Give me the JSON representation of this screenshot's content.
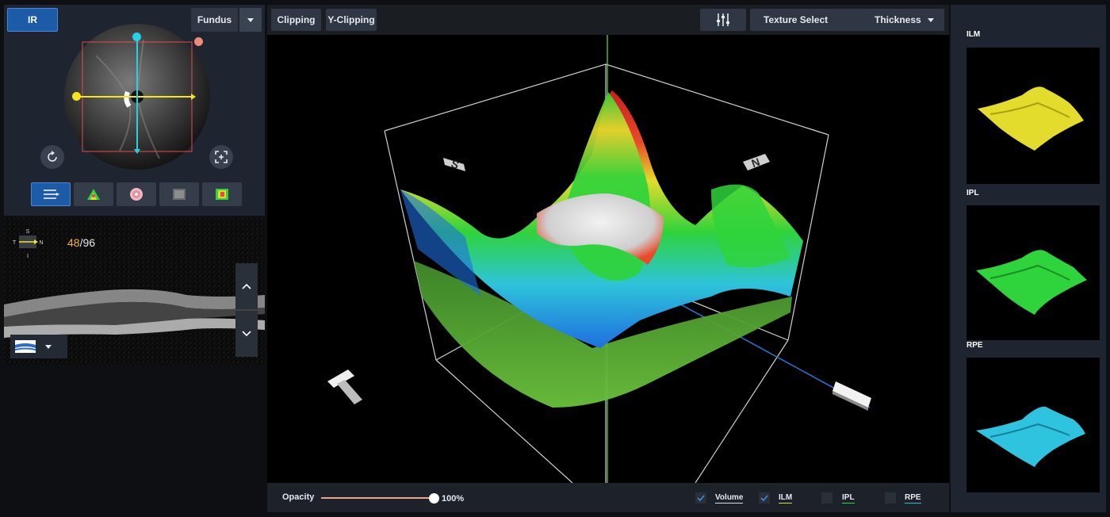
{
  "fundus": {
    "mode_label": "IR",
    "source_select": "Fundus"
  },
  "bscan": {
    "compass": {
      "north": "S",
      "south": "I",
      "west": "T",
      "east": "N"
    },
    "slice_current": "48",
    "slice_separator": "/",
    "slice_total": "96"
  },
  "toolbar": {
    "clipping_label": "Clipping",
    "y_clipping_label": "Y-Clipping",
    "texture_label": "Texture Select",
    "texture_value": "Thickness"
  },
  "viewer": {
    "orientation_labels": [
      "S",
      "N",
      "T",
      "I"
    ]
  },
  "bottom": {
    "opacity_label": "Opacity",
    "opacity_value": "100%",
    "opacity_level": 100,
    "layers": [
      {
        "label": "Volume",
        "checked": true,
        "underline": "#d8dde6"
      },
      {
        "label": "ILM",
        "checked": true,
        "underline": "#d9d14a"
      },
      {
        "label": "IPL",
        "checked": false,
        "underline": "#3ecf4a"
      },
      {
        "label": "RPE",
        "checked": false,
        "underline": "#35b9d9"
      }
    ]
  },
  "right": {
    "layers": [
      {
        "title": "ILM",
        "color": "#e3dc2c"
      },
      {
        "title": "IPL",
        "color": "#2fd33b"
      },
      {
        "title": "RPE",
        "color": "#2ec4e0"
      }
    ]
  },
  "icons": {
    "rotate": "refresh-icon",
    "fit": "fit-screen-icon",
    "modes": [
      "line-scan-icon",
      "thickness-map-icon",
      "etdrs-grid-icon",
      "enface-icon",
      "heatmap-icon"
    ]
  },
  "colors": {
    "accent": "#1d5aa8",
    "slice_current": "#f2b531",
    "scan_line_h": "#f5e51e",
    "scan_line_v": "#22d3e6",
    "scan_box": "#e84a4a"
  }
}
